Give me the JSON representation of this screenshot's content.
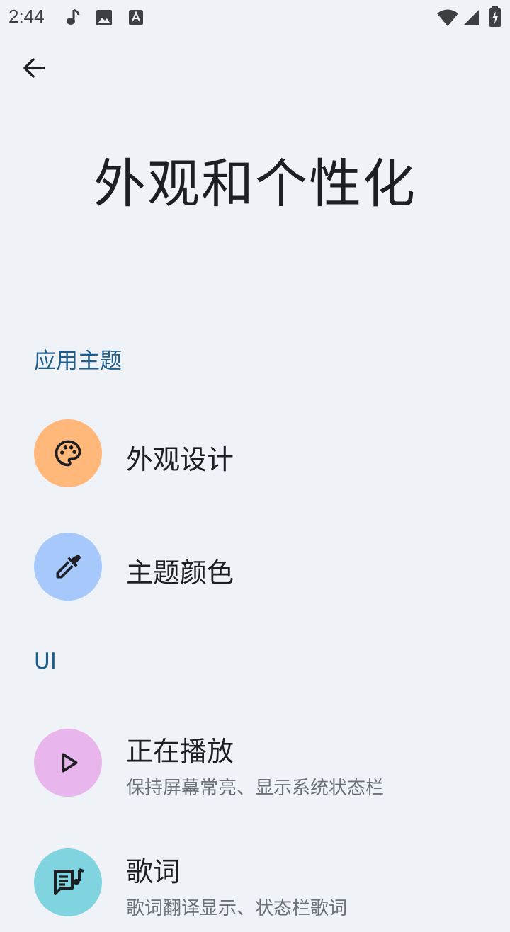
{
  "status_bar": {
    "time": "2:44",
    "left_icons": [
      "music-note-icon",
      "image-icon",
      "font-icon"
    ],
    "right_icons": [
      "wifi-icon",
      "cell-signal-icon",
      "battery-charging-icon"
    ]
  },
  "header": {
    "back_icon": "arrow-left-icon",
    "title": "外观和个性化"
  },
  "sections": [
    {
      "header": "应用主题",
      "items": [
        {
          "title": "外观设计",
          "subtitle": "",
          "icon": "palette-icon",
          "color": "#ffb77a"
        },
        {
          "title": "主题颜色",
          "subtitle": "",
          "icon": "eyedropper-icon",
          "color": "#a6c8fb"
        }
      ]
    },
    {
      "header": "UI",
      "items": [
        {
          "title": "正在播放",
          "subtitle": "保持屏幕常亮、显示系统状态栏",
          "icon": "play-icon",
          "color": "#e8b6ec"
        },
        {
          "title": "歌词",
          "subtitle": "歌词翻译显示、状态栏歌词",
          "icon": "lyrics-icon",
          "color": "#80d4e0"
        }
      ]
    }
  ],
  "colors": {
    "background": "#eff3f8",
    "section_header": "#1f5d8a",
    "title_text": "#1c1f23",
    "subtitle_text": "#6b7177"
  }
}
